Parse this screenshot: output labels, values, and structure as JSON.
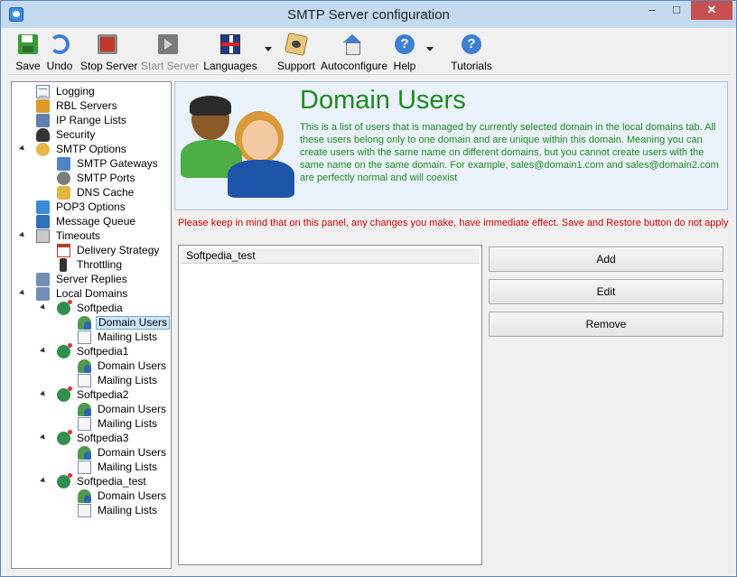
{
  "window": {
    "title": "SMTP Server configuration",
    "controls": {
      "minimize": "–",
      "maximize": "□",
      "close": "✕"
    }
  },
  "toolbar": {
    "buttons": [
      {
        "label": "Save",
        "icon": "save-icon",
        "enabled": true
      },
      {
        "label": "Undo",
        "icon": "undo-icon",
        "enabled": true
      },
      {
        "label": "Stop Server",
        "icon": "stop-icon",
        "enabled": true
      },
      {
        "label": "Start Server",
        "icon": "play-icon",
        "enabled": false
      },
      {
        "label": "Languages",
        "icon": "flag-icon",
        "enabled": true,
        "dropdown": true
      },
      {
        "label": "Support",
        "icon": "support-icon",
        "enabled": true
      },
      {
        "label": "Autoconfigure",
        "icon": "home-icon",
        "enabled": true
      },
      {
        "label": "Help",
        "icon": "help-icon",
        "glyph": "?",
        "enabled": true,
        "dropdown": true
      },
      {
        "label": "Tutorials",
        "icon": "help-icon",
        "glyph": "?",
        "enabled": true
      }
    ]
  },
  "tree": {
    "items": [
      {
        "label": "Logging",
        "icon": "log-icon"
      },
      {
        "label": "RBL Servers",
        "icon": "rbl-icon"
      },
      {
        "label": "IP Range Lists",
        "icon": "ip-range-icon"
      },
      {
        "label": "Security",
        "icon": "security-icon"
      },
      {
        "label": "SMTP Options",
        "icon": "smtp-icon",
        "expanded": true
      },
      {
        "label": "SMTP Gateways",
        "icon": "gateway-icon"
      },
      {
        "label": "SMTP Ports",
        "icon": "ports-icon"
      },
      {
        "label": "DNS Cache",
        "icon": "cache-icon"
      },
      {
        "label": "POP3 Options",
        "icon": "pop3-icon"
      },
      {
        "label": "Message Queue",
        "icon": "queue-icon"
      },
      {
        "label": "Timeouts",
        "icon": "timeout-icon",
        "expanded": true
      },
      {
        "label": "Delivery Strategy",
        "icon": "calendar-icon"
      },
      {
        "label": "Throttling",
        "icon": "traffic-light-icon"
      },
      {
        "label": "Server Replies",
        "icon": "server-icon"
      },
      {
        "label": "Local Domains",
        "icon": "domains-icon",
        "expanded": true
      },
      {
        "label": "Softpedia",
        "icon": "globe-icon",
        "expanded": true
      },
      {
        "label": "Domain Users",
        "icon": "users-icon",
        "selected": true
      },
      {
        "label": "Mailing Lists",
        "icon": "mail-list-icon"
      },
      {
        "label": "Softpedia1",
        "icon": "globe-icon",
        "expanded": true
      },
      {
        "label": "Domain Users",
        "icon": "users-icon"
      },
      {
        "label": "Mailing Lists",
        "icon": "mail-list-icon"
      },
      {
        "label": "Softpedia2",
        "icon": "globe-icon",
        "expanded": true
      },
      {
        "label": "Domain Users",
        "icon": "users-icon"
      },
      {
        "label": "Mailing Lists",
        "icon": "mail-list-icon"
      },
      {
        "label": "Softpedia3",
        "icon": "globe-icon",
        "expanded": true
      },
      {
        "label": "Domain Users",
        "icon": "users-icon"
      },
      {
        "label": "Mailing Lists",
        "icon": "mail-list-icon"
      },
      {
        "label": "Softpedia_test",
        "icon": "globe-icon",
        "expanded": true
      },
      {
        "label": "Domain Users",
        "icon": "users-icon"
      },
      {
        "label": "Mailing Lists",
        "icon": "mail-list-icon"
      }
    ]
  },
  "info": {
    "title": "Domain Users",
    "description": "This is a list of users that is managed by currently selected domain in the local domains tab. All these users belong only to one domain and are unique within this domain. Meaning you can create users with the same name on different domains, but you cannot create users with the same name on the same domain. For example, sales@domain1.com and sales@domain2.com are perfectly normal and will coexist",
    "title_color": "#1f8a1f"
  },
  "warning": {
    "text": "Please keep in mind that on this panel, any changes you make, have immediate effect. Save and Restore button do not apply",
    "color": "#d40000"
  },
  "users": {
    "rows": [
      "Softpedia_test"
    ]
  },
  "actions": {
    "add": "Add",
    "edit": "Edit",
    "remove": "Remove"
  }
}
